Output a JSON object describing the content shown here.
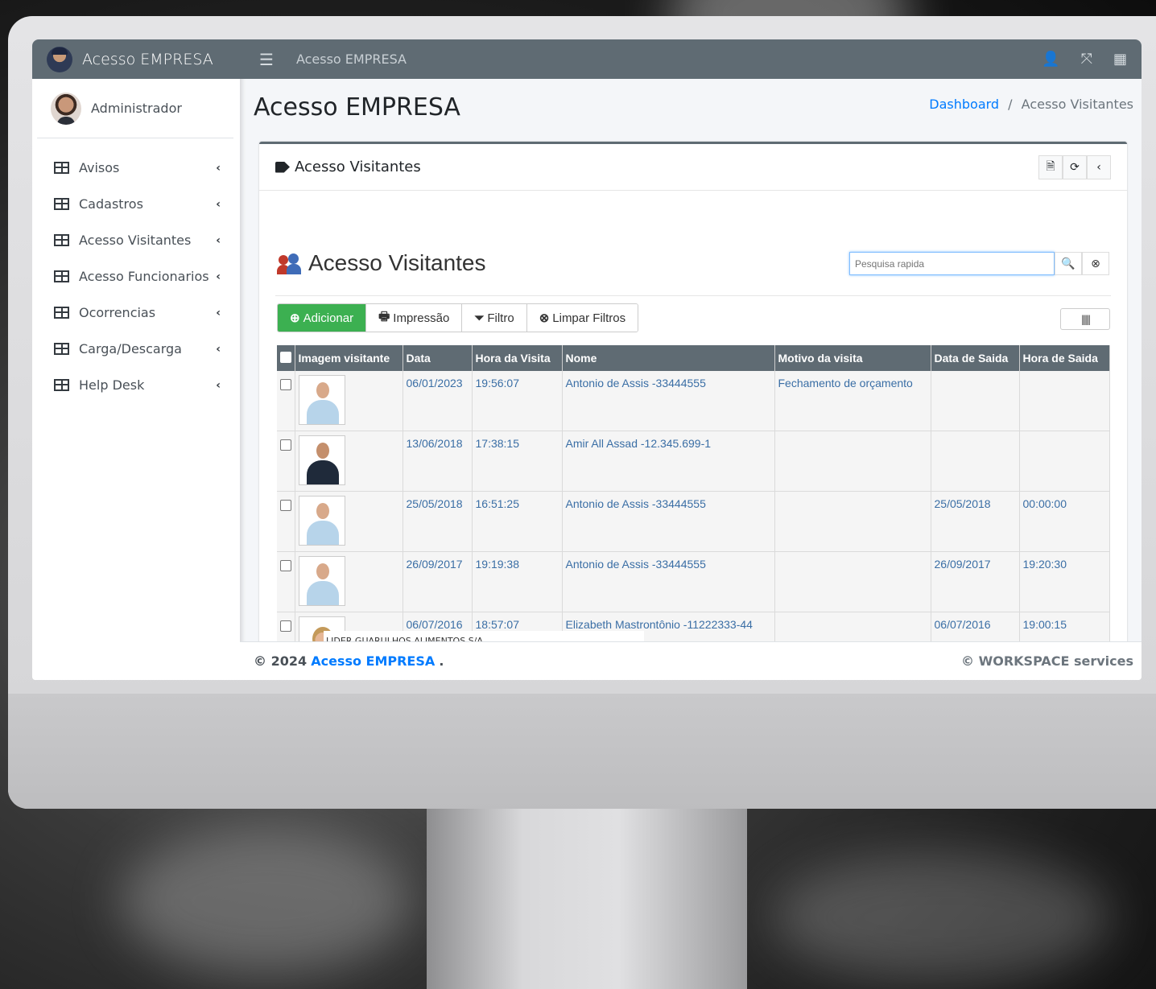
{
  "brand": {
    "title": "Acesso EMPRESA"
  },
  "user": {
    "name": "Administrador"
  },
  "sidebar": {
    "items": [
      {
        "label": "Avisos"
      },
      {
        "label": "Cadastros"
      },
      {
        "label": "Acesso Visitantes"
      },
      {
        "label": "Acesso Funcionarios"
      },
      {
        "label": "Ocorrencias"
      },
      {
        "label": "Carga/Descarga"
      },
      {
        "label": "Help Desk"
      }
    ]
  },
  "topbar": {
    "title": "Acesso EMPRESA"
  },
  "page": {
    "title": "Acesso EMPRESA"
  },
  "breadcrumb": {
    "home": "Dashboard",
    "separator": "/",
    "current": "Acesso Visitantes"
  },
  "card": {
    "title": "Acesso Visitantes"
  },
  "grid": {
    "title": "Acesso Visitantes",
    "search_placeholder": "Pesquisa rapida",
    "buttons": {
      "add": "Adicionar",
      "print": "Impressão",
      "filter": "Filtro",
      "clear": "Limpar Filtros"
    },
    "columns": [
      "Imagem visitante",
      "Data",
      "Hora da Visita",
      "Nome",
      "Motivo da visita",
      "Data de Saida",
      "Hora de Saida"
    ],
    "rows": [
      {
        "date": "06/01/2023",
        "time": "19:56:07",
        "name": "Antonio de Assis -33444555",
        "reason": "Fechamento de orçamento",
        "out_date": "",
        "out_time": ""
      },
      {
        "date": "13/06/2018",
        "time": "17:38:15",
        "name": "Amir All Assad -12.345.699-1",
        "reason": "",
        "out_date": "",
        "out_time": ""
      },
      {
        "date": "25/05/2018",
        "time": "16:51:25",
        "name": "Antonio de Assis -33444555",
        "reason": "",
        "out_date": "25/05/2018",
        "out_time": "00:00:00"
      },
      {
        "date": "26/09/2017",
        "time": "19:19:38",
        "name": "Antonio de Assis -33444555",
        "reason": "",
        "out_date": "26/09/2017",
        "out_time": "19:20:30"
      },
      {
        "date": "06/07/2016",
        "time": "18:57:07",
        "name": "Elizabeth Mastrontônio -11222333-44",
        "reason": "",
        "out_date": "06/07/2016",
        "out_time": "19:00:15"
      }
    ]
  },
  "overlay": {
    "label": "LIDER GUARULHOS ALIMENTOS S/A"
  },
  "footer": {
    "copyright": "© 2024",
    "brand": "Acesso EMPRESA",
    "dot": ".",
    "right": "© WORKSPACE services"
  },
  "colors": {
    "header": "#5f6b73",
    "add_button": "#3cb051",
    "link": "#007bff"
  }
}
